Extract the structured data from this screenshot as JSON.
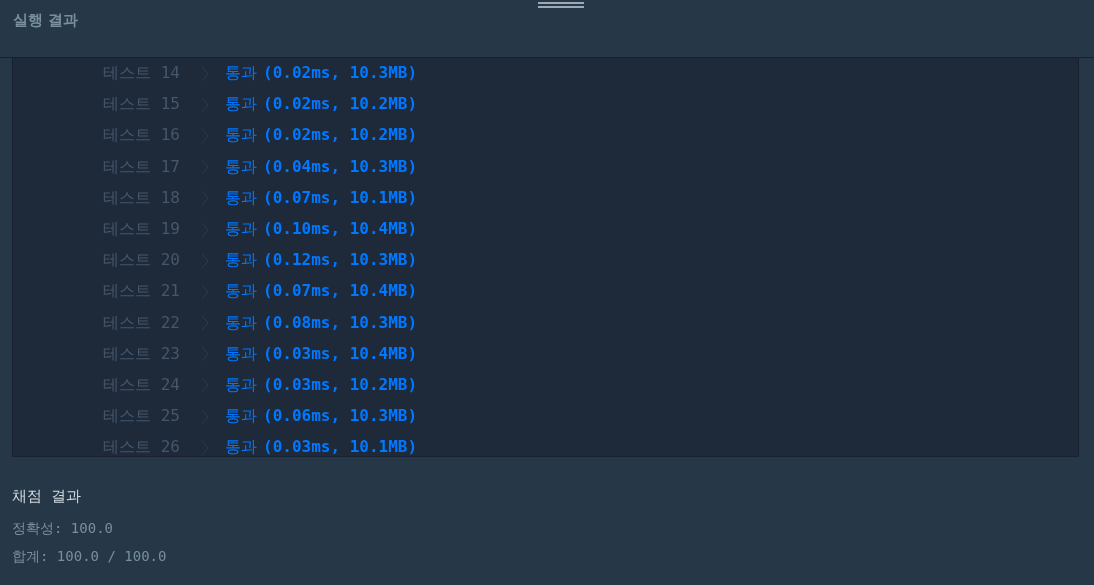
{
  "header": {
    "title": "실행 결과"
  },
  "tests": [
    {
      "label": "테스트 14",
      "status": "통과",
      "detail": "(0.02ms, 10.3MB)"
    },
    {
      "label": "테스트 15",
      "status": "통과",
      "detail": "(0.02ms, 10.2MB)"
    },
    {
      "label": "테스트 16",
      "status": "통과",
      "detail": "(0.02ms, 10.2MB)"
    },
    {
      "label": "테스트 17",
      "status": "통과",
      "detail": "(0.04ms, 10.3MB)"
    },
    {
      "label": "테스트 18",
      "status": "통과",
      "detail": "(0.07ms, 10.1MB)"
    },
    {
      "label": "테스트 19",
      "status": "통과",
      "detail": "(0.10ms, 10.4MB)"
    },
    {
      "label": "테스트 20",
      "status": "통과",
      "detail": "(0.12ms, 10.3MB)"
    },
    {
      "label": "테스트 21",
      "status": "통과",
      "detail": "(0.07ms, 10.4MB)"
    },
    {
      "label": "테스트 22",
      "status": "통과",
      "detail": "(0.08ms, 10.3MB)"
    },
    {
      "label": "테스트 23",
      "status": "통과",
      "detail": "(0.03ms, 10.4MB)"
    },
    {
      "label": "테스트 24",
      "status": "통과",
      "detail": "(0.03ms, 10.2MB)"
    },
    {
      "label": "테스트 25",
      "status": "통과",
      "detail": "(0.06ms, 10.3MB)"
    },
    {
      "label": "테스트 26",
      "status": "통과",
      "detail": "(0.03ms, 10.1MB)"
    }
  ],
  "summary": {
    "title": "채점 결과",
    "lines": [
      "정확성: 100.0",
      "합계: 100.0 / 100.0"
    ]
  }
}
